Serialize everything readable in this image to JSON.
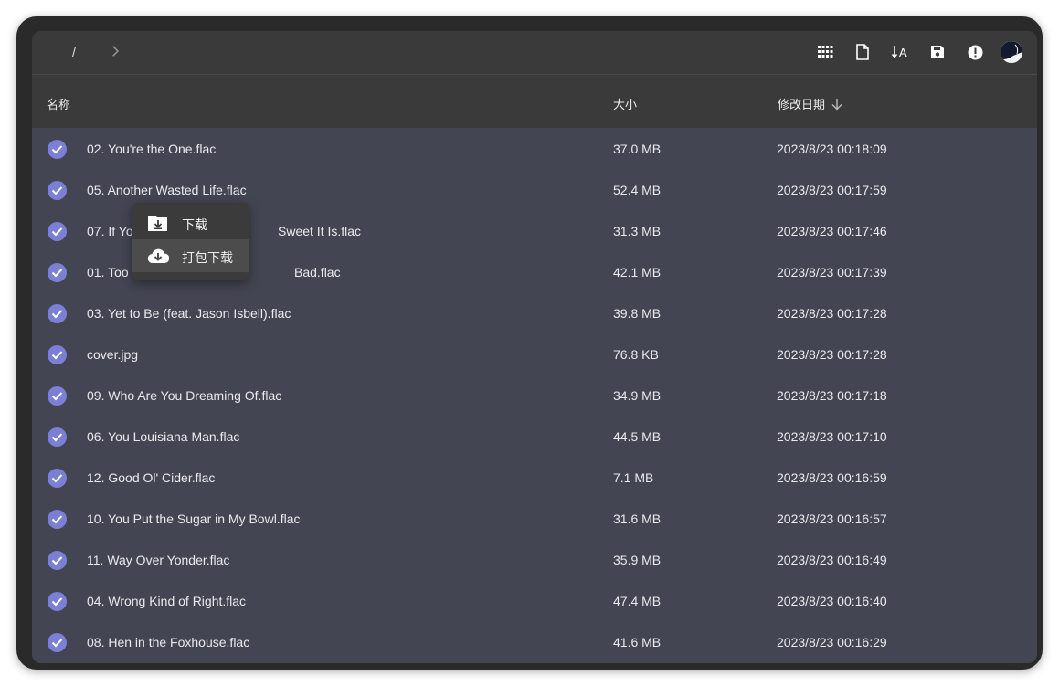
{
  "breadcrumb": {
    "separator": "/"
  },
  "toolbar": {
    "icons": [
      "grid-view-icon",
      "file-select-icon",
      "sort-alpha-icon",
      "save-icon",
      "info-alert-icon",
      "avatar"
    ]
  },
  "columns": {
    "name": "名称",
    "size": "大小",
    "date": "修改日期"
  },
  "files": [
    {
      "name": "02. You're the One.flac",
      "size": "37.0 MB",
      "date": "2023/8/23 00:18:09"
    },
    {
      "name": "05. Another Wasted Life.flac",
      "size": "52.4 MB",
      "date": "2023/8/23 00:17:59"
    },
    {
      "name": "07. If Yo",
      "name_tail": "Sweet It Is.flac",
      "size": "31.3 MB",
      "date": "2023/8/23 00:17:46"
    },
    {
      "name": "01. Too ",
      "name_tail": "Bad.flac",
      "size": "42.1 MB",
      "date": "2023/8/23 00:17:39"
    },
    {
      "name": "03. Yet to Be (feat. Jason Isbell).flac",
      "size": "39.8 MB",
      "date": "2023/8/23 00:17:28"
    },
    {
      "name": "cover.jpg",
      "size": "76.8 KB",
      "date": "2023/8/23 00:17:28"
    },
    {
      "name": "09. Who Are You Dreaming Of.flac",
      "size": "34.9 MB",
      "date": "2023/8/23 00:17:18"
    },
    {
      "name": "06. You Louisiana Man.flac",
      "size": "44.5 MB",
      "date": "2023/8/23 00:17:10"
    },
    {
      "name": "12. Good Ol' Cider.flac",
      "size": "7.1 MB",
      "date": "2023/8/23 00:16:59"
    },
    {
      "name": "10. You Put the Sugar in My Bowl.flac",
      "size": "31.6 MB",
      "date": "2023/8/23 00:16:57"
    },
    {
      "name": "11. Way Over Yonder.flac",
      "size": "35.9 MB",
      "date": "2023/8/23 00:16:49"
    },
    {
      "name": "04. Wrong Kind of Right.flac",
      "size": "47.4 MB",
      "date": "2023/8/23 00:16:40"
    },
    {
      "name": "08. Hen in the Foxhouse.flac",
      "size": "41.6 MB",
      "date": "2023/8/23 00:16:29"
    }
  ],
  "context_menu": {
    "items": [
      {
        "label": "下载",
        "icon": "folder-download-icon"
      },
      {
        "label": "打包下载",
        "icon": "cloud-download-icon"
      }
    ]
  },
  "colors": {
    "accent": "#7b80d6",
    "list_bg": "#444552",
    "header_bg": "#3a3a3a"
  }
}
